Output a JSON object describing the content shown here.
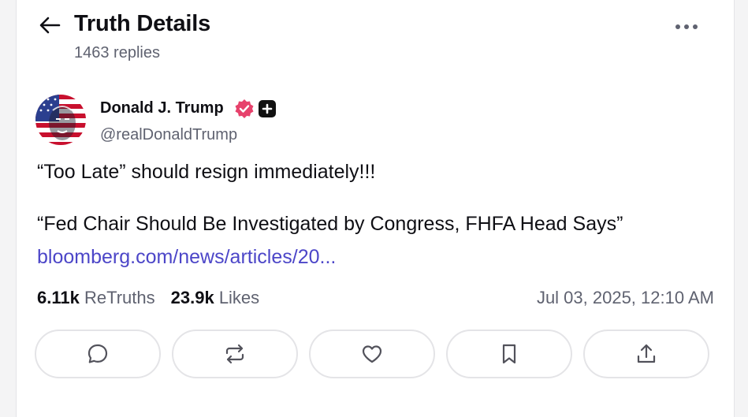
{
  "header": {
    "title": "Truth Details",
    "replies": "1463 replies"
  },
  "author": {
    "name": "Donald J. Trump",
    "handle": "@realDonaldTrump"
  },
  "post": {
    "text_line1": "“Too Late” should resign immediately!!!",
    "text_line2": "“Fed Chair Should Be Investigated by Congress, FHFA Head Says”",
    "link": "bloomberg.com/news/articles/20..."
  },
  "stats": {
    "retruths_count": "6.11k",
    "retruths_label": "ReTruths",
    "likes_count": "23.9k",
    "likes_label": "Likes",
    "timestamp": "Jul 03, 2025, 12:10 AM"
  },
  "actions": [
    {
      "icon": "reply-icon"
    },
    {
      "icon": "retruth-icon"
    },
    {
      "icon": "like-heart-icon"
    },
    {
      "icon": "bookmark-icon"
    },
    {
      "icon": "share-icon"
    }
  ],
  "colors": {
    "link": "#4c46c8",
    "verified": "#e7426c",
    "muted_text": "#5f6270",
    "border": "#e4e4e7"
  }
}
